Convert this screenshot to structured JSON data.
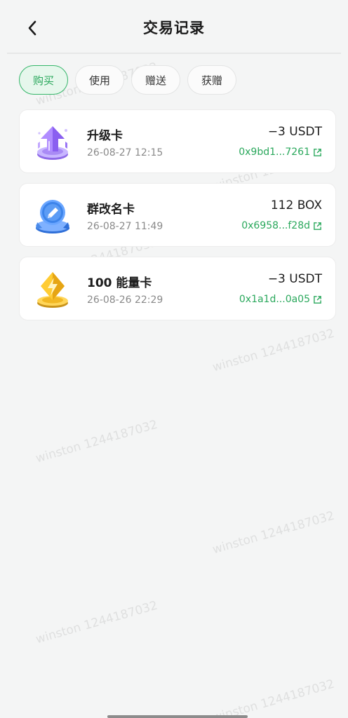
{
  "header": {
    "title": "交易记录"
  },
  "tabs": [
    {
      "label": "购买",
      "active": true
    },
    {
      "label": "使用",
      "active": false
    },
    {
      "label": "赠送",
      "active": false
    },
    {
      "label": "获赠",
      "active": false
    }
  ],
  "records": [
    {
      "name": "升级卡",
      "date": "26-08-27 12:15",
      "amount": "−3 USDT",
      "hash": "0x9bd1...7261",
      "icon": "upgrade-arrow-icon"
    },
    {
      "name": "群改名卡",
      "date": "26-08-27 11:49",
      "amount": "112 BOX",
      "hash": "0x6958...f28d",
      "icon": "rename-pencil-icon"
    },
    {
      "name": "100 能量卡",
      "date": "26-08-26 22:29",
      "amount": "−3 USDT",
      "hash": "0x1a1d...0a05",
      "icon": "energy-bolt-icon"
    }
  ],
  "watermark": "winston 1244187032",
  "colors": {
    "accent": "#2aa85c",
    "background": "#f4f5f5"
  }
}
